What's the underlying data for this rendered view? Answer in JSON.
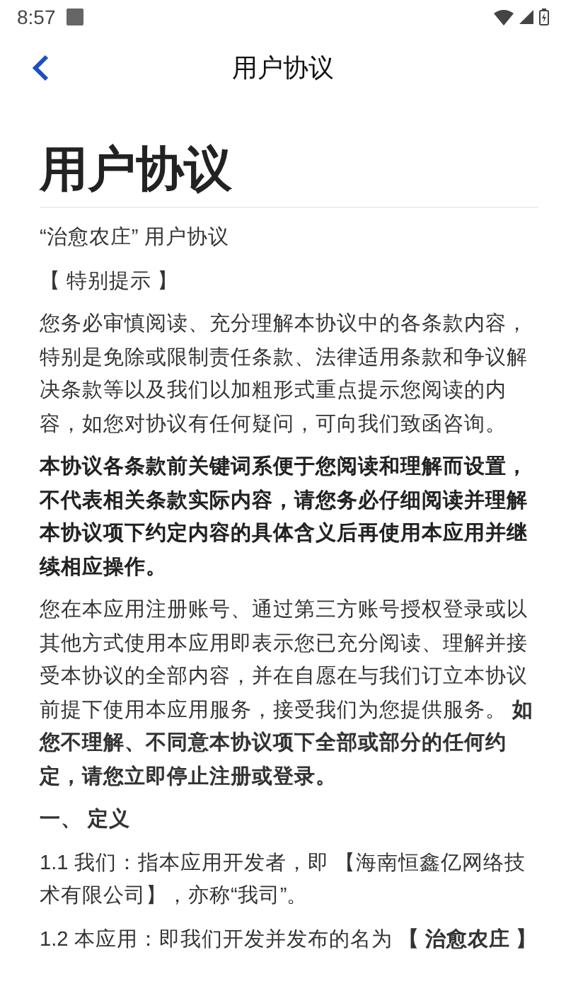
{
  "status_bar": {
    "time": "8:57"
  },
  "header": {
    "title": "用户协议"
  },
  "document": {
    "title": "用户协议",
    "paragraphs": [
      {
        "kind": "text",
        "text": "“治愈农庄” 用户协议"
      },
      {
        "kind": "text",
        "text": "【 特别提示 】"
      },
      {
        "kind": "text",
        "text": "您务必审慎阅读、充分理解本协议中的各条款内容，特别是免除或限制责任条款、法律适用条款和争议解决条款等以及我们以加粗形式重点提示您阅读的内容，如您对协议有任何疑问，可向我们致函咨询。"
      },
      {
        "kind": "bold",
        "text": "本协议各条款前关键词系便于您阅读和理解而设置，不代表相关条款实际内容，请您务必仔细阅读并理解本协议项下约定内容的具体含义后再使用本应用并继续相应操作。"
      },
      {
        "kind": "text",
        "text": "您在本应用注册账号、通过第三方账号授权登录或以其他方式使用本应用即表示您已充分阅读、理解并接受本协议的全部内容，并在自愿在与我们订立本协议前提下使用本应用服务，接受我们为您提供服务。 **如您不理解、不同意本协议项下全部或部分的任何约定，请您立即停止注册或登录。**"
      },
      {
        "kind": "heading",
        "text": "一、 定义"
      },
      {
        "kind": "text",
        "text": "1.1 我们：指本应用开发者，即 【海南恒鑫亿网络技术有限公司】，亦称“我司”。"
      },
      {
        "kind": "text",
        "text": "1.2 本应用：即我们开发并发布的名为 **【 治愈农庄 】**"
      }
    ]
  }
}
